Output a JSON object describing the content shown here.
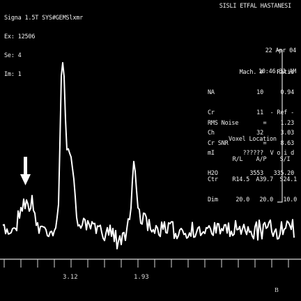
{
  "header": {
    "lines": [
      "Signa 1.5T SYS#GEMSlxmr",
      "Ex: 12506",
      "Se: 4",
      "Im: 1"
    ],
    "hospital": "SISLI ETFAL HASTANESI"
  },
  "datetime": {
    "date": "22 Apr 04",
    "time": "10:46:31 AM"
  },
  "metabolites": {
    "headers": [
      "",
      "Mach. #",
      "Ratio"
    ],
    "rows": [
      [
        "NA",
        "10",
        "0.94"
      ],
      [
        "Cr",
        "11",
        "- Ref -"
      ],
      [
        "Ch",
        "32",
        "3.03"
      ],
      [
        "mI",
        "??????",
        "V o i d"
      ],
      [
        "H2O",
        "3553",
        "335.20"
      ]
    ]
  },
  "noise": {
    "rows": [
      {
        "label": "RMS Noise",
        "eq": "=",
        "value": "1.23"
      },
      {
        "label": "Cr SNR",
        "eq": "=",
        "value": "8.63"
      }
    ]
  },
  "voxel": {
    "title": "Voxel Location",
    "headers": [
      "R/L",
      "A/P",
      "S/I"
    ],
    "rows": [
      {
        "label": "Ctr",
        "values": [
          "R14.5",
          "A39.7",
          "S24.1"
        ]
      },
      {
        "label": "Dim",
        "values": [
          "20.0",
          "20.0",
          "10.0"
        ]
      }
    ]
  },
  "axis": {
    "ticks": [
      "3.12",
      "1.93"
    ]
  },
  "panel_letter": "B",
  "annotation": "arrow-marker",
  "colors": {
    "background": "#000000",
    "trace": "#ffffff",
    "text": "#f0f0f0"
  }
}
